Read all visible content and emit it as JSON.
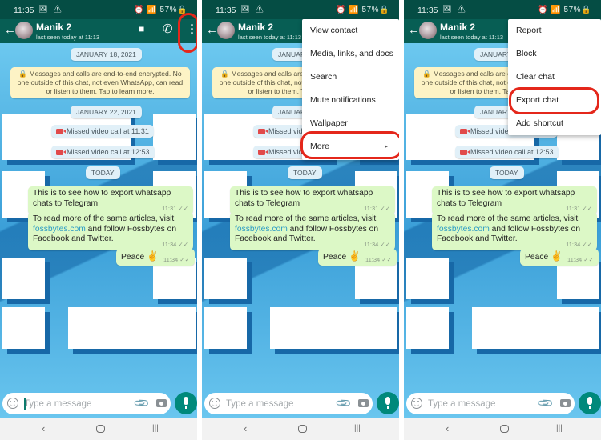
{
  "status_bar": {
    "time": "11:35",
    "left_icons": "🖼 ⚠",
    "right_text": "⏰ 📶 57%🔒"
  },
  "chat": {
    "contact_name": "Manik 2",
    "last_seen": "last seen today at 11:13",
    "back_icon": "←",
    "video_icon": "■",
    "call_icon": "✆",
    "more_icon": "⋮"
  },
  "messages": {
    "date1": "JANUARY 18, 2021",
    "encryption_notice": "🔒 Messages and calls are end-to-end encrypted. No one outside of this chat, not even WhatsApp, can read or listen to them. Tap to learn more.",
    "date2": "JANUARY 22, 2021",
    "missed_call_1": "Missed video call at 11:31",
    "missed_call_2": "Missed video call at 12:53",
    "date3": "TODAY",
    "msg1_text": "This is to see how to export whatsapp chats to Telegram",
    "msg1_time": "11:31 ✓✓",
    "msg2_pre": "To read more of the same articles, visit ",
    "msg2_link": "fossbytes.com",
    "msg2_post": " and follow Fossbytes on Facebook and Twitter.",
    "msg2_time": "11:34 ✓✓",
    "msg3_text": "Peace ",
    "msg3_emoji": "✌",
    "msg3_time": "11:34 ✓✓"
  },
  "composer": {
    "placeholder": "Type a message",
    "attach_icon": "📎"
  },
  "navbar": {
    "back": "‹",
    "recents": "|||"
  },
  "menu_main": {
    "items": [
      "View contact",
      "Media, links, and docs",
      "Search",
      "Mute notifications",
      "Wallpaper",
      "More"
    ],
    "more_arrow": "▸"
  },
  "menu_more": {
    "items": [
      "Report",
      "Block",
      "Clear chat",
      "Export chat",
      "Add shortcut"
    ]
  },
  "colors": {
    "header": "#075e54",
    "status": "#054d44",
    "highlight": "#e4271b",
    "bubble_out": "#dcf8c6",
    "accent": "#00897b"
  }
}
